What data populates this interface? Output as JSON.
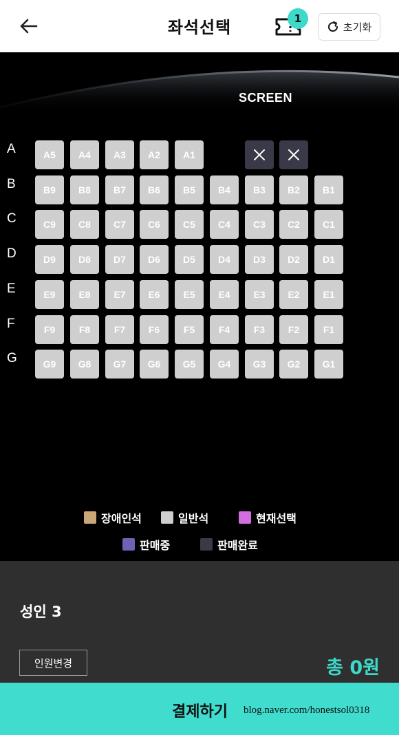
{
  "header": {
    "title": "좌석선택",
    "ticket_badge": "1",
    "reset_label": "초기화"
  },
  "screen": {
    "label": "SCREEN"
  },
  "rows": [
    {
      "label": "A",
      "seats": [
        "A5",
        "A4",
        "A3",
        "A2",
        "A1"
      ],
      "sold_count": 2
    },
    {
      "label": "B",
      "seats": [
        "B9",
        "B8",
        "B7",
        "B6",
        "B5",
        "B4",
        "B3",
        "B2",
        "B1"
      ]
    },
    {
      "label": "C",
      "seats": [
        "C9",
        "C8",
        "C7",
        "C6",
        "C5",
        "C4",
        "C3",
        "C2",
        "C1"
      ]
    },
    {
      "label": "D",
      "seats": [
        "D9",
        "D8",
        "D7",
        "D6",
        "D5",
        "D4",
        "D3",
        "D2",
        "D1"
      ]
    },
    {
      "label": "E",
      "seats": [
        "E9",
        "E8",
        "E7",
        "E6",
        "E5",
        "E4",
        "E3",
        "E2",
        "E1"
      ]
    },
    {
      "label": "F",
      "seats": [
        "F9",
        "F8",
        "F7",
        "F6",
        "F5",
        "F4",
        "F3",
        "F2",
        "F1"
      ]
    },
    {
      "label": "G",
      "seats": [
        "G9",
        "G8",
        "G7",
        "G6",
        "G5",
        "G4",
        "G3",
        "G2",
        "G1"
      ]
    }
  ],
  "legend": [
    {
      "label": "장애인석",
      "color": "#c9a777"
    },
    {
      "label": "일반석",
      "color": "#cfcfcf"
    },
    {
      "label": "현재선택",
      "color": "#d36ee0"
    },
    {
      "label": "판매중",
      "color": "#6b63b5"
    },
    {
      "label": "판매완료",
      "color": "#3a3947"
    }
  ],
  "bottom": {
    "people": "성인 3",
    "change_label": "인원변경",
    "total": "총 0원"
  },
  "pay": {
    "label": "결제하기",
    "watermark": "blog.naver.com/honestsol0318"
  },
  "colors": {
    "accent": "#40dccd",
    "seat_available": "#cfcfcf",
    "seat_sold": "#3a3947"
  }
}
